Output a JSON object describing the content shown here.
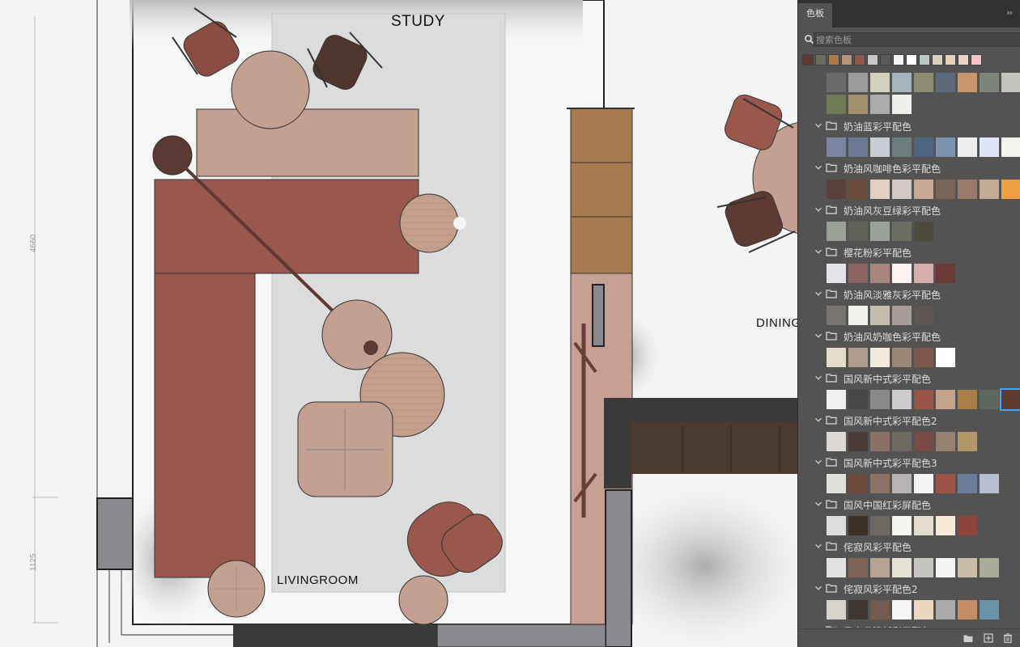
{
  "plan": {
    "labels": {
      "study": "STUDY",
      "living": "LIVINGROOM",
      "dining": "DINING"
    },
    "dimensions": {
      "d1": "4660",
      "d2": "1125"
    }
  },
  "panel": {
    "tab_label": "色板",
    "collapse_icon": "double-chevron-right-icon",
    "search": {
      "placeholder": "搜索色板",
      "value": ""
    },
    "recent_swatches": [
      "#5e3a32",
      "#6b6b62",
      "#a87a4e",
      "#b4947f",
      "#8f5a4d",
      "#c8c8c8",
      "#5a5a5a",
      "#f2f2f2",
      "#ffffff",
      "#bcc8c4",
      "#d8d0c0",
      "#e2d2bc",
      "#e9d3c8",
      "#f2c4c4"
    ],
    "top_swatches": [
      "#6a6a6a",
      "#9b9b9b",
      "#d4d0c0",
      "#a6b4bc",
      "#8e8c70",
      "#5c6a7c",
      "#c8966c",
      "#7e8478",
      "#c4c4bc",
      "#6e7a58",
      "#a0906c",
      "#acacac",
      "#f0f0ea"
    ],
    "groups": [
      {
        "name": "奶油蓝彩平配色",
        "swatches": [
          "#7a86a0",
          "#6c7a94",
          "#c8ccd4",
          "#6c7e7e",
          "#4e6480",
          "#7e94ae",
          "#eeeeee",
          "#dde5f6",
          "#f4f4ee"
        ]
      },
      {
        "name": "奶油风咖啡色彩平配色",
        "swatches": [
          "#5a4038",
          "#6a4a3a",
          "#e2d0c4",
          "#d2c8c4",
          "#c6aa96",
          "#7a6456",
          "#9a7a6a",
          "#c2aa94",
          "#f0a040"
        ]
      },
      {
        "name": "奶油风灰豆绿彩平配色",
        "swatches": [
          "#9aa096",
          "#5e6258",
          "#9aa298",
          "#6c6e64",
          "#4e4a3e"
        ]
      },
      {
        "name": "樱花粉彩平配色",
        "swatches": [
          "#e4e4e8",
          "#8a6260",
          "#a88680",
          "#fcf2f2",
          "#d6acac",
          "#6a3a36"
        ]
      },
      {
        "name": "奶油风淡雅灰彩平配色",
        "swatches": [
          "#787470",
          "#f2f0ea",
          "#c4bcae",
          "#a89c98",
          "#5e5652"
        ]
      },
      {
        "name": "奶油风奶咖色彩平配色",
        "swatches": [
          "#e4dcc8",
          "#b09c8c",
          "#f2eadc",
          "#9c8676",
          "#7e584a",
          "#ffffff"
        ]
      },
      {
        "name": "国风新中式彩平配色",
        "swatches": [
          "#f0f0f0",
          "#474747",
          "#8a8a8a",
          "#cccccc",
          "#9a5448",
          "#c4a28c",
          "#a87e48",
          "#5e6660",
          "#5e3a30"
        ]
      },
      {
        "name": "国风新中式彩平配色2",
        "swatches": [
          "#dcd8d4",
          "#4a3c36",
          "#8a7066",
          "#6e6a62",
          "#7a4a46",
          "#968070",
          "#b09868"
        ]
      },
      {
        "name": "国风新中式彩平配色3",
        "swatches": [
          "#e2e0dc",
          "#6c4a3e",
          "#8c7262",
          "#b8b4b4",
          "#f4f4f4",
          "#9c5446",
          "#6a7c98",
          "#b6c0d0"
        ]
      },
      {
        "name": "国风中国红彩屏配色",
        "swatches": [
          "#dcdcdc",
          "#3a3026",
          "#6e6860",
          "#f4f4f0",
          "#e2ddcc",
          "#f6ead8",
          "#8e443c"
        ]
      },
      {
        "name": "侘寂风彩平配色",
        "swatches": [
          "#e2e2e2",
          "#7e6456",
          "#b4a494",
          "#e6e2d6",
          "#c6c4be",
          "#f4f4f2",
          "#c8bca8",
          "#aaaa98"
        ]
      },
      {
        "name": "侘寂风彩平配色2",
        "swatches": [
          "#d8d4cc",
          "#3e3430",
          "#765a4c",
          "#f6f6f8",
          "#ecd8c0",
          "#aaaaa8",
          "#c48e62",
          "#6a94a8"
        ]
      },
      {
        "name": "马卡龙清新彩平配色",
        "swatches": []
      }
    ],
    "footer_icons": [
      "folder-icon",
      "new-swatch-icon",
      "trash-icon"
    ]
  }
}
